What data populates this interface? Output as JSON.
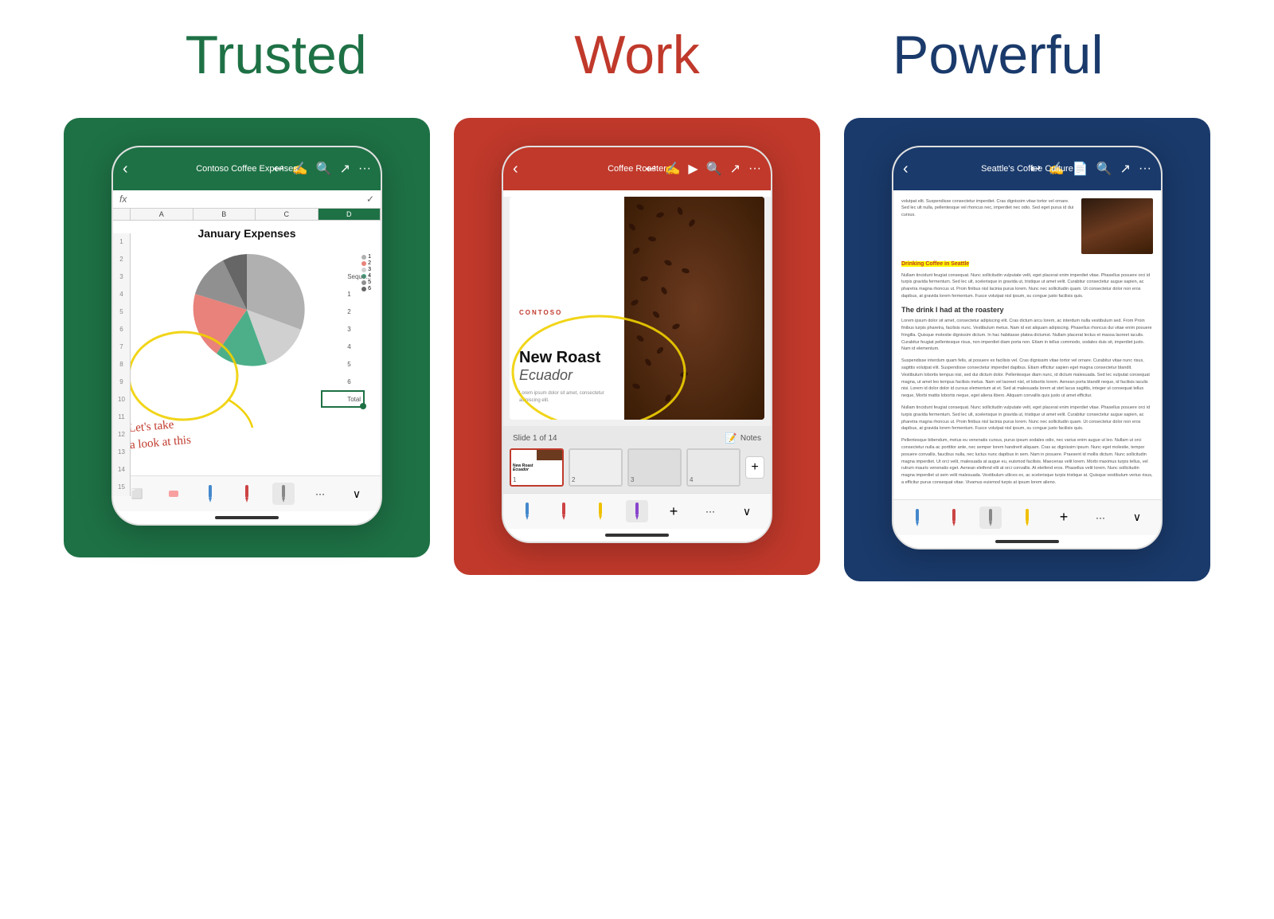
{
  "titles": {
    "trusted": "Trusted",
    "work": "Work",
    "powerful": "Powerful"
  },
  "colors": {
    "green": "#1e7145",
    "red": "#c0392b",
    "blue": "#1a3a6b",
    "yellow_annotation": "#f0d000"
  },
  "excel_phone": {
    "header_title": "Contoso Coffee Expenses",
    "formula_label": "fx",
    "chart_title": "January Expenses",
    "annotation": "Let's take\na look at this",
    "columns": [
      "A",
      "B",
      "C",
      "D"
    ],
    "legend": [
      "1",
      "2",
      "3",
      "4",
      "5",
      "6"
    ],
    "toolbar_icons": [
      "⬜",
      "🧹",
      "✏",
      "✏",
      "✏",
      "···",
      "∨"
    ]
  },
  "ppt_phone": {
    "header_title": "Coffee Roaster",
    "slide_info": "Slide 1 of 14",
    "notes_label": "Notes",
    "logo_text": "CONTOSO",
    "new_roast": "New Roast",
    "ecuador": "Ecuador",
    "small_text": "Lorem ipsum dolor sit amet, consectetur adipiscing elit.",
    "toolbar_icons": [
      "✏",
      "✏",
      "✏",
      "✏",
      "+",
      "···",
      "∨"
    ],
    "slide_count": 4
  },
  "word_phone": {
    "header_title": "Seattle's Coffee Culture",
    "highlighted_text": "Drinking Coffee in Seattle",
    "section_title": "The drink I had at the roastery",
    "body_text_1": "Lorem ipsum dolor sit amet, consectetur adipiscing elit. Cras dictum arcu lorem, ac interdum nulla vestibulum sed. From Proin finibus turpis pharetra, facilisis nunc maximus. Vestibulum metus. Nam id est aliquam...",
    "body_text_2": "Suspendisse interdum quam felis, at posuere ex facilisis vel. Cras dignissim vitae tortor vel ornare. Curabitur vitae nunc risus, sagittis volutpat elit. Suspendisse consectetur imperdiet dapibus...",
    "body_text_3": "Nullam tincidunt feugiat consequat. Nunc sollicitudin vulputate velit, eget placerat enim imperdiet vitae. Phasellus posuere orci ut turpis gravida fermentum...",
    "body_text_4": "Pellentesque bibendum, metus eu venenatis cursus, purus ipsum sodales odio, nec varius enim augue ut leo...",
    "toolbar_icons": [
      "✏",
      "✏",
      "✏",
      "✏",
      "+",
      "···",
      "∨"
    ]
  }
}
